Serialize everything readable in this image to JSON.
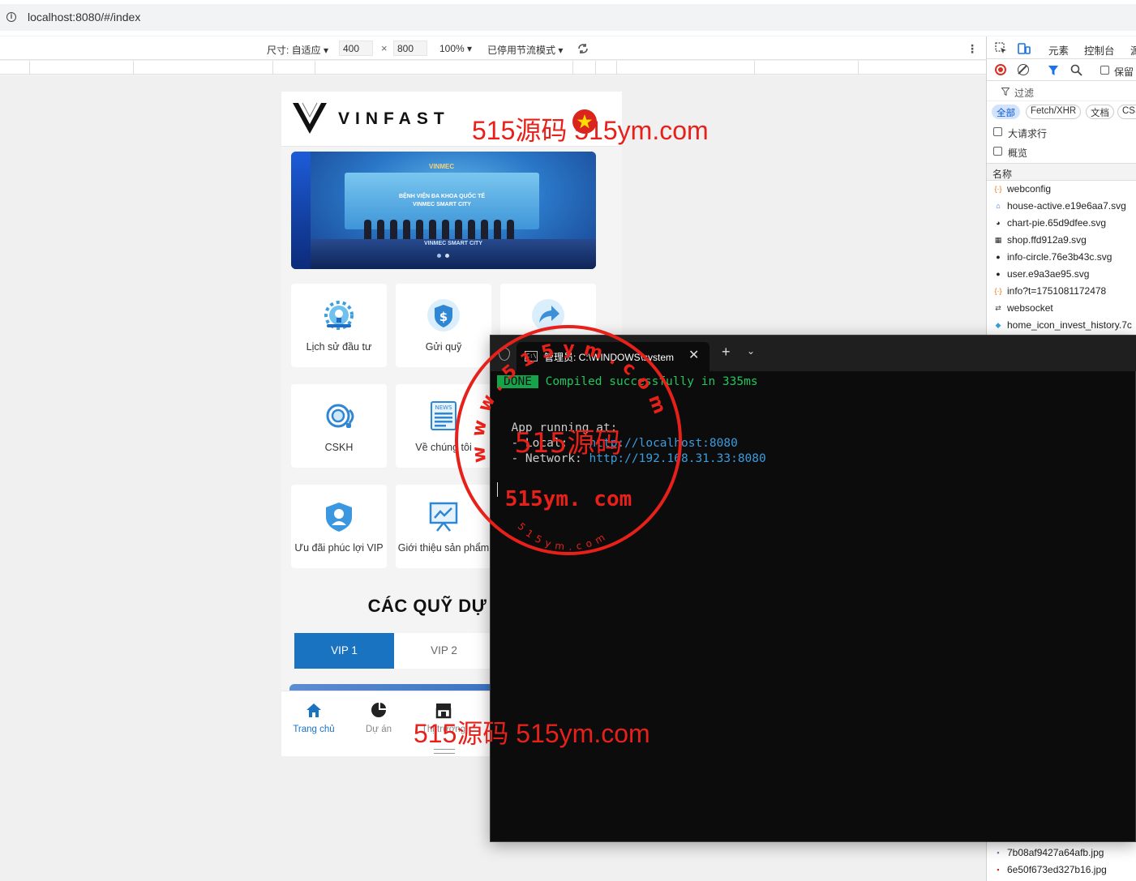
{
  "browser": {
    "url": "localhost:8080/#/index"
  },
  "device_toolbar": {
    "size_label": "尺寸: 自适应 ▾",
    "width": "400",
    "height": "800",
    "times": "×",
    "zoom": "100% ▾",
    "throttle": "已停用节流模式 ▾"
  },
  "app": {
    "brand": "VINFAST",
    "banner": {
      "logo_text": "VINMEC",
      "screen_line1": "BỆNH VIỆN ĐA KHOA QUỐC TẾ",
      "screen_line2": "VINMEC SMART CITY",
      "floor_text": "VINMEC SMART CITY"
    },
    "menu": [
      {
        "label": "Lịch sử đầu tư",
        "icon": "gear-bulb-icon"
      },
      {
        "label": "Gửi quỹ",
        "icon": "shield-dollar-icon"
      },
      {
        "label": "",
        "icon": "share-arrow-icon"
      },
      {
        "label": "CSKH",
        "icon": "headset-icon"
      },
      {
        "label": "Về chúng tôi",
        "icon": "news-icon"
      },
      {
        "label": "Ưu đãi phúc lợi VIP",
        "icon": "vip-shield-icon"
      },
      {
        "label": "Giới thiệu sản phẩm",
        "icon": "presentation-icon"
      }
    ],
    "funds_title": "CÁC QUỸ DỰ",
    "tabs": [
      {
        "label": "VIP 1",
        "active": true
      },
      {
        "label": "VIP 2",
        "active": false
      }
    ],
    "tabbar": [
      {
        "label": "Trang chủ",
        "icon": "home-icon",
        "active": true
      },
      {
        "label": "Dự án",
        "icon": "pie-chart-icon",
        "active": false
      },
      {
        "label": "Thị trường",
        "icon": "shop-icon",
        "active": false
      }
    ]
  },
  "devtools": {
    "tabs": [
      "元素",
      "控制台",
      "源"
    ],
    "preserve_log": "保留",
    "filter_placeholder": "过滤",
    "types": [
      "全部",
      "Fetch/XHR",
      "文档",
      "CSS"
    ],
    "big_rows": "大请求行",
    "overview": "概览",
    "name_header": "名称",
    "requests": [
      {
        "name": "webconfig",
        "icon": "{·}",
        "color": "#e8710a"
      },
      {
        "name": "house-active.e19e6aa7.svg",
        "icon": "⌂",
        "color": "#1a73e8"
      },
      {
        "name": "chart-pie.65d9dfee.svg",
        "icon": "◕",
        "color": "#222"
      },
      {
        "name": "shop.ffd912a9.svg",
        "icon": "▦",
        "color": "#222"
      },
      {
        "name": "info-circle.76e3b43c.svg",
        "icon": "●",
        "color": "#222"
      },
      {
        "name": "user.e9a3ae95.svg",
        "icon": "●",
        "color": "#222"
      },
      {
        "name": "info?t=1751081172478",
        "icon": "{·}",
        "color": "#e8710a"
      },
      {
        "name": "websocket",
        "icon": "⇄",
        "color": "#444"
      },
      {
        "name": "home_icon_invest_history.7c",
        "icon": "◆",
        "color": "#3aa0d8"
      }
    ],
    "requests_bottom": [
      {
        "name": "7b08af9427a64afb.jpg",
        "icon": "▪",
        "color": "#6b7ca3"
      },
      {
        "name": "6e50f673ed327b16.jpg",
        "icon": "▪",
        "color": "#b33"
      }
    ]
  },
  "terminal": {
    "tab_title": "管理员: C:\\WINDOWS\\system",
    "tab_icon": "C:\\",
    "done_badge": "DONE",
    "compiled": "Compiled successfully in 335ms",
    "running": "App running at:",
    "local_label": "- Local:   ",
    "local_url": "http://localhost:8080",
    "network_label": "- Network: ",
    "network_url": "http://192.168.31.33:8080"
  },
  "watermarks": {
    "top": "515源码 515ym.com",
    "bottom": "515源码 515ym.com",
    "seal_center": "515源码",
    "seal_bottom": "515ym. com",
    "seal_ring": "www.515ym.com",
    "seal_small": "515ym.com"
  }
}
